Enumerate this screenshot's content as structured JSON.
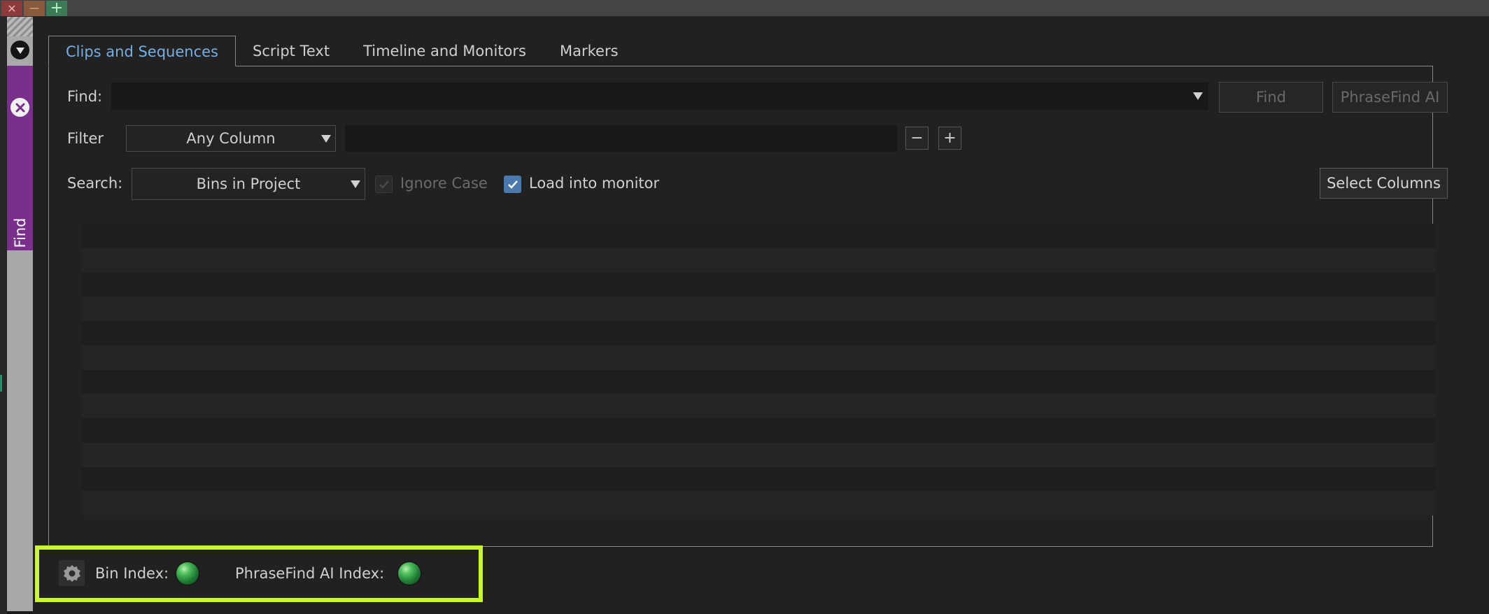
{
  "window": {
    "close_glyph": "✕",
    "minimize_glyph": "—",
    "maximize_glyph": "+"
  },
  "sidebar": {
    "find_tab_label": "Find"
  },
  "tabs": [
    {
      "label": "Clips and Sequences",
      "active": true
    },
    {
      "label": "Script Text",
      "active": false
    },
    {
      "label": "Timeline and Monitors",
      "active": false
    },
    {
      "label": "Markers",
      "active": false
    }
  ],
  "find_row": {
    "label": "Find:",
    "value": "",
    "find_button": "Find",
    "phrasefind_button": "PhraseFind AI"
  },
  "filter_row": {
    "label": "Filter",
    "column_select": "Any Column",
    "value": "",
    "minus": "−",
    "plus": "+"
  },
  "search_row": {
    "label": "Search:",
    "scope_select": "Bins in Project",
    "ignore_case_label": "Ignore Case",
    "ignore_case_checked": true,
    "ignore_case_disabled": true,
    "load_monitor_label": "Load into monitor",
    "load_monitor_checked": true,
    "select_columns_button": "Select Columns"
  },
  "footer": {
    "bin_index_label": "Bin Index:",
    "bin_index_status": "ready",
    "phrasefind_index_label": "PhraseFind AI Index:",
    "phrasefind_index_status": "ready"
  },
  "colors": {
    "accent_tab": "#76aee6",
    "find_tab": "#7a2f8d",
    "checkbox_checked": "#4a79ad",
    "highlight": "#c8f53a",
    "status_led": "#2f9e47"
  }
}
